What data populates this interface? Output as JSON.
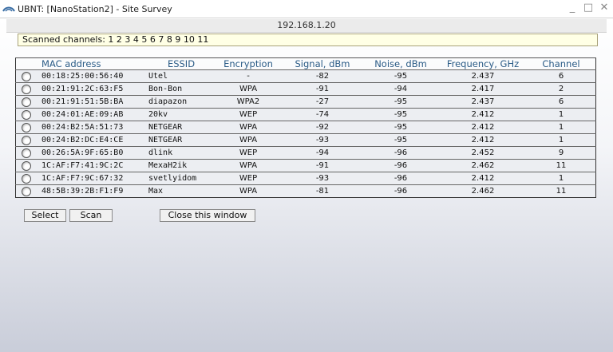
{
  "window": {
    "title": "UBNT: [NanoStation2] - Site Survey",
    "controls": {
      "minimize": "_",
      "maximize": "□",
      "close": "✕"
    }
  },
  "address": "192.168.1.20",
  "scanned_channels": "Scanned channels: 1 2 3 4 5 6 7 8 9 10 11",
  "table": {
    "headers": [
      "MAC address",
      "ESSID",
      "Encryption",
      "Signal, dBm",
      "Noise, dBm",
      "Frequency, GHz",
      "Channel"
    ],
    "rows": [
      {
        "mac": "00:18:25:00:56:40",
        "essid": "Utel",
        "enc": "-",
        "signal": "-82",
        "noise": "-95",
        "freq": "2.437",
        "channel": "6"
      },
      {
        "mac": "00:21:91:2C:63:F5",
        "essid": "Bon-Bon",
        "enc": "WPA",
        "signal": "-91",
        "noise": "-94",
        "freq": "2.417",
        "channel": "2"
      },
      {
        "mac": "00:21:91:51:5B:BA",
        "essid": "diapazon",
        "enc": "WPA2",
        "signal": "-27",
        "noise": "-95",
        "freq": "2.437",
        "channel": "6"
      },
      {
        "mac": "00:24:01:AE:09:AB",
        "essid": "20kv",
        "enc": "WEP",
        "signal": "-74",
        "noise": "-95",
        "freq": "2.412",
        "channel": "1"
      },
      {
        "mac": "00:24:B2:5A:51:73",
        "essid": "NETGEAR",
        "enc": "WPA",
        "signal": "-92",
        "noise": "-95",
        "freq": "2.412",
        "channel": "1"
      },
      {
        "mac": "00:24:B2:DC:E4:CE",
        "essid": "NETGEAR",
        "enc": "WPA",
        "signal": "-93",
        "noise": "-95",
        "freq": "2.412",
        "channel": "1"
      },
      {
        "mac": "00:26:5A:9F:65:B0",
        "essid": "dlink",
        "enc": "WEP",
        "signal": "-94",
        "noise": "-96",
        "freq": "2.452",
        "channel": "9"
      },
      {
        "mac": "1C:AF:F7:41:9C:2C",
        "essid": "MexaH2ik",
        "enc": "WPA",
        "signal": "-91",
        "noise": "-96",
        "freq": "2.462",
        "channel": "11"
      },
      {
        "mac": "1C:AF:F7:9C:67:32",
        "essid": "svetlyidom",
        "enc": "WEP",
        "signal": "-93",
        "noise": "-96",
        "freq": "2.412",
        "channel": "1"
      },
      {
        "mac": "48:5B:39:2B:F1:F9",
        "essid": "Max",
        "enc": "WPA",
        "signal": "-81",
        "noise": "-96",
        "freq": "2.462",
        "channel": "11"
      }
    ]
  },
  "buttons": {
    "select": "Select",
    "scan": "Scan",
    "close": "Close this window"
  },
  "icons": {
    "app": "ubnt-logo-icon"
  }
}
